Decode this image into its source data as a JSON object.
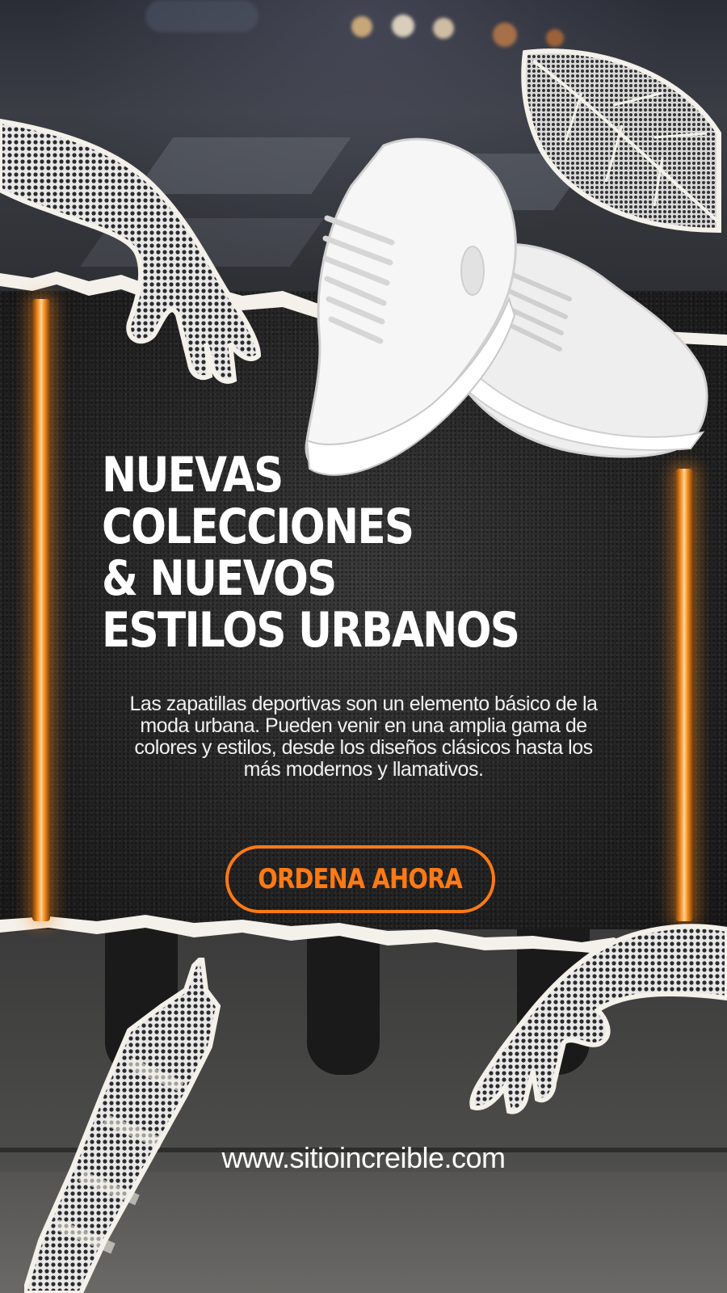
{
  "headline": {
    "line1": "NUEVAS",
    "line2": "COLECCIONES",
    "line3": "& NUEVOS",
    "line4": "ESTILOS URBANOS"
  },
  "description": "Las zapatillas deportivas son un elemento básico de la moda urbana. Pueden venir en una amplia gama de colores y estilos, desde los diseños clásicos hasta los más modernos y llamativos.",
  "cta": {
    "label": "ORDENA AHORA"
  },
  "website": "www.sitioincreible.com",
  "colors": {
    "accent": "#ff7a14",
    "text": "#ffffff",
    "panel": "#262626",
    "paper": "#f4f1ea"
  },
  "icons": {
    "top_left": "halftone-hand-icon",
    "top_right": "halftone-leaf-icon",
    "bottom_left": "halftone-tower-icon",
    "bottom_right": "halftone-hand-icon",
    "product": "white-sneakers-image"
  }
}
